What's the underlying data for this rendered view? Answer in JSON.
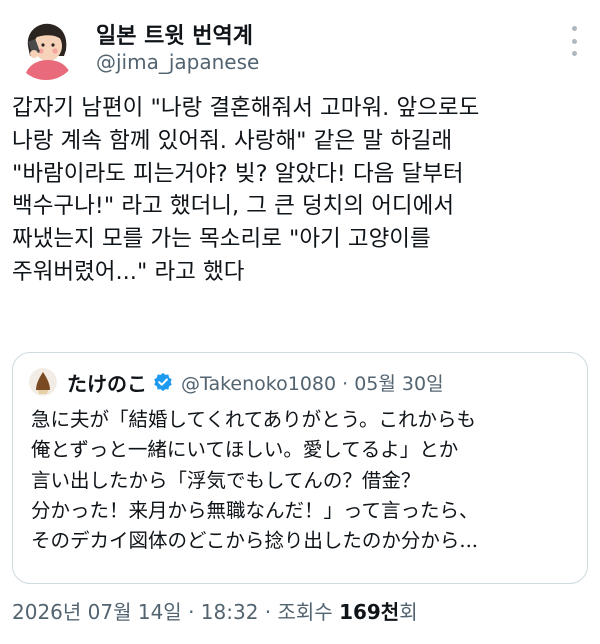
{
  "author": {
    "display_name": "일본 트윗 번역계",
    "handle": "@jima_japanese"
  },
  "tweet": {
    "text": "갑자기 남편이 \"나랑 결혼해줘서 고마워. 앞으로도\n나랑 계속 함께 있어줘. 사랑해\" 같은 말 하길래\n\"바람이라도 피는거야? 빚? 알았다! 다음 달부터\n백수구나!\" 라고 했더니, 그 큰 덩치의 어디에서\n짜냈는지 모를 가는 목소리로 \"아기 고양이를\n주워버렸어...\" 라고 했다"
  },
  "quoted_tweet": {
    "display_name": "たけのこ",
    "meta": "@Takenoko1080 · 05월 30일",
    "text": "急に夫が「結婚してくれてありがとう。これからも\n俺とずっと一緒にいてほしい。愛してるよ」とか\n言い出したから「浮気でもしてんの？借金？\n分かった！来月から無職なんだ！」って言ったら、\nそのデカイ図体のどこから捻り出したのか分から..."
  },
  "footer": {
    "date": "2026년 07월 14일 · 18:32 · 조회수 ",
    "views": "169천",
    "views_suffix": "회"
  },
  "icons": {
    "more": "more-vertical-icon",
    "verified": "verified-badge-icon",
    "verified_color": "#1d9bf0"
  }
}
